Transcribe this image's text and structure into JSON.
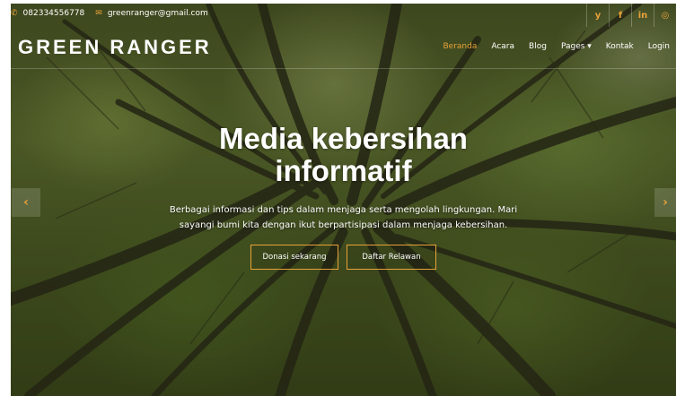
{
  "topbar": {
    "phone": "082334556778",
    "email": "greenranger@gmail.com",
    "social": [
      {
        "icon": "twitter-icon",
        "glyph": "y"
      },
      {
        "icon": "facebook-icon",
        "glyph": "f"
      },
      {
        "icon": "linkedin-icon",
        "glyph": "in"
      },
      {
        "icon": "instagram-icon",
        "glyph": "◎"
      }
    ]
  },
  "navbar": {
    "brand": "GREEN RANGER",
    "menu": [
      "Beranda",
      "Acara",
      "Blog",
      "Pages ▾",
      "Kontak",
      "Login"
    ],
    "active_index": 0
  },
  "hero": {
    "title_line1": "Media kebersihan",
    "title_line2": "informatif",
    "description": "Berbagai informasi dan tips dalam menjaga serta mengolah lingkungan. Mari sayangi bumi kita dengan ikut berpartisipasi dalam menjaga kebersihan.",
    "button_primary": "Donasi sekarang",
    "button_secondary": "Daftar Relawan",
    "prev_glyph": "‹",
    "next_glyph": "›"
  },
  "colors": {
    "accent": "#e8a23a",
    "text": "#ffffff"
  }
}
